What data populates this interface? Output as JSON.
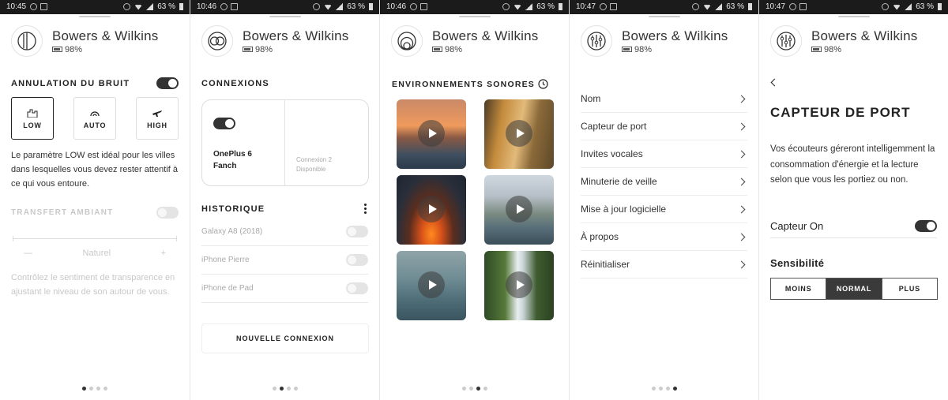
{
  "status_bars": [
    {
      "time": "10:45",
      "battery": "63 %"
    },
    {
      "time": "10:46",
      "battery": "63 %"
    },
    {
      "time": "10:46",
      "battery": "63 %"
    },
    {
      "time": "10:47",
      "battery": "63 %"
    },
    {
      "time": "10:47",
      "battery": "63 %"
    }
  ],
  "brand": {
    "name": "Bowers & Wilkins",
    "battery": "98%"
  },
  "icons": {
    "logo": "headphones-logo-icon",
    "battery": "battery-icon",
    "play": "play-icon",
    "chevron": "chevron-right-icon",
    "back": "chevron-left-icon",
    "menu": "kebab-menu-icon",
    "clock": "clock-icon"
  },
  "colors": {
    "accent": "#333333",
    "disabled": "#c8c8c8",
    "border": "#dddddd"
  },
  "noise": {
    "title": "ANNULATION DU BRUIT",
    "enabled": true,
    "modes": [
      {
        "label": "LOW",
        "icon": "city-icon",
        "selected": true
      },
      {
        "label": "AUTO",
        "icon": "auto-icon",
        "selected": false
      },
      {
        "label": "HIGH",
        "icon": "airplane-icon",
        "selected": false
      }
    ],
    "description": "Le paramètre LOW est idéal pour les villes dans lesquelles vous devez rester attentif à ce qui vous entoure.",
    "ambient_title": "TRANSFERT AMBIANT",
    "ambient_enabled": false,
    "minus": "—",
    "slider_label": "Naturel",
    "plus": "+",
    "ambient_description": "Contrôlez le sentiment de transparence en ajustant le niveau de son autour de vous."
  },
  "connections": {
    "title": "CONNEXIONS",
    "device1_line1": "OnePlus 6",
    "device1_line2": "Fanch",
    "device2_line1": "Connexion 2",
    "device2_line2": "Disponible",
    "history_title": "HISTORIQUE",
    "history": [
      "Galaxy A8 (2018)",
      "iPhone Pierre",
      "iPhone de Pad"
    ],
    "new_connection": "NOUVELLE CONNEXION"
  },
  "environments": {
    "title": "ENVIRONNEMENTS SONORES",
    "tiles": [
      "sunset-sea",
      "autumn-forest",
      "campfire",
      "mountain-river",
      "rainy-window",
      "waterfall"
    ]
  },
  "settings": {
    "items": [
      "Nom",
      "Capteur de port",
      "Invites vocales",
      "Minuterie de veille",
      "Mise à jour logicielle",
      "À propos",
      "Réinitialiser"
    ]
  },
  "sensor": {
    "title": "CAPTEUR DE PORT",
    "description": "Vos écouteurs géreront intelligemment la consommation d'énergie et la lecture selon que vous les portiez ou non.",
    "toggle_label": "Capteur On",
    "enabled": true,
    "sensitivity_title": "Sensibilité",
    "options": [
      "MOINS",
      "NORMAL",
      "PLUS"
    ],
    "selected": "NORMAL"
  },
  "pager": {
    "count": 4,
    "active": [
      0,
      1,
      2,
      3,
      3
    ]
  }
}
